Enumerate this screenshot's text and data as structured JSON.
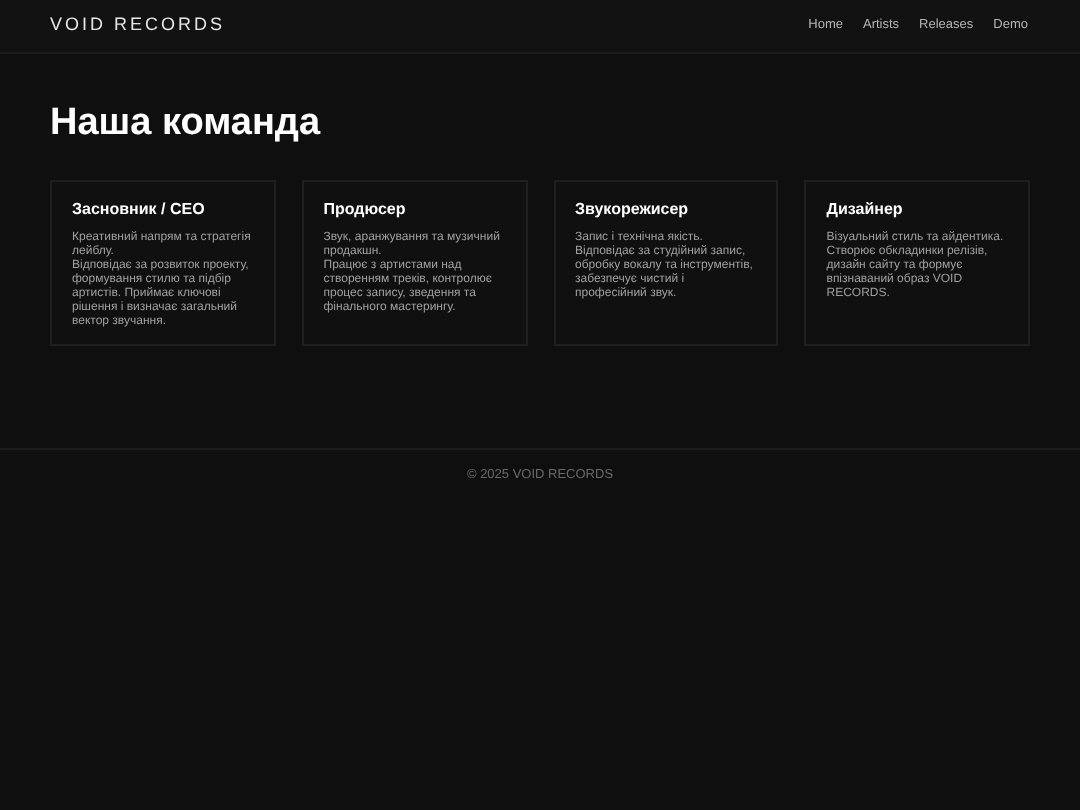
{
  "header": {
    "logo": "VOID RECORDS",
    "nav": [
      "Home",
      "Artists",
      "Releases",
      "Demo"
    ]
  },
  "page_title": "Наша команда",
  "team": [
    {
      "role": "Засновник / CEO",
      "lines": [
        "Креативний напрям та стратегія лейблу.",
        "Відповідає за розвиток проекту, формування стилю та підбір артистів. Приймає ключові рішення і визначає загальний вектор звучання."
      ]
    },
    {
      "role": "Продюсер",
      "lines": [
        "Звук, аранжування та музичний продакшн.",
        "Працює з артистами над створенням треків, контролює процес запису, зведення та фінального мастерингу."
      ]
    },
    {
      "role": "Звукорежисер",
      "lines": [
        "Запис і технічна якість.",
        "Відповідає за студійний запис, обробку вокалу та інструментів, забезпечує чистий і професійний звук."
      ]
    },
    {
      "role": "Дизайнер",
      "lines": [
        "Візуальний стиль та айдентика.",
        "Створює обкладинки релізів, дизайн сайту та формує впізнаваний образ VOID RECORDS."
      ]
    }
  ],
  "footer": "© 2025 VOID RECORDS"
}
